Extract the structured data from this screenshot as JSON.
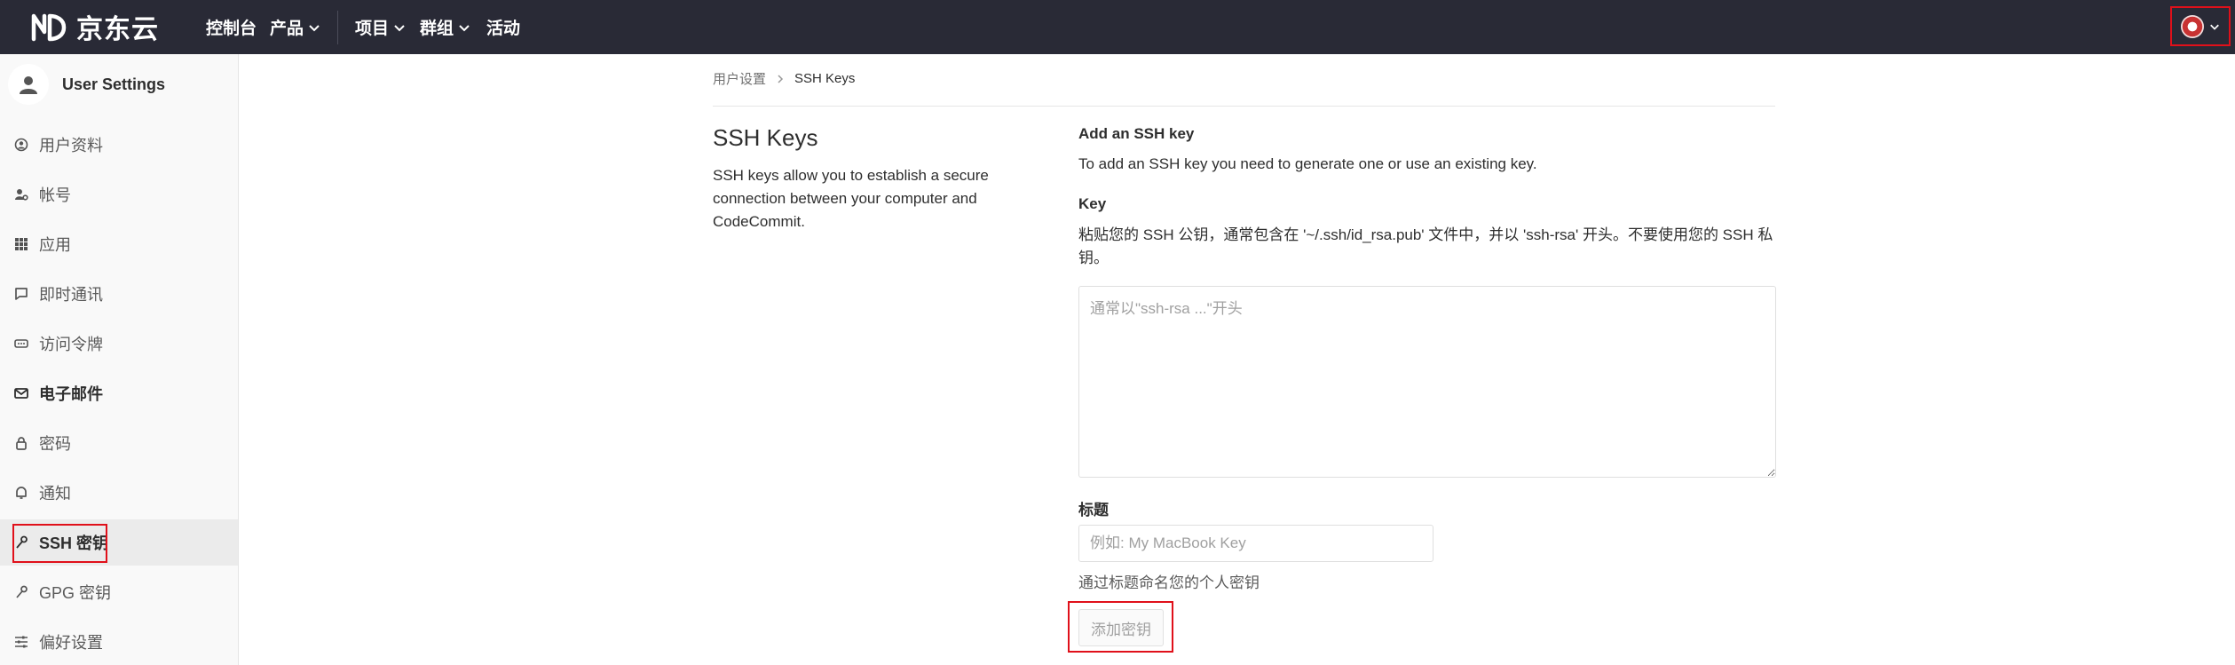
{
  "topbar": {
    "logo_text": "京东云",
    "nav": [
      {
        "label": "控制台",
        "has_dropdown": false
      },
      {
        "label": "产品",
        "has_dropdown": true
      },
      {
        "label": "项目",
        "has_dropdown": true
      },
      {
        "label": "群组",
        "has_dropdown": true
      },
      {
        "label": "活动",
        "has_dropdown": false
      }
    ]
  },
  "sidebar": {
    "title": "User Settings",
    "items": [
      {
        "label": "用户资料",
        "icon": "user-circle-icon"
      },
      {
        "label": "帐号",
        "icon": "account-gear-icon"
      },
      {
        "label": "应用",
        "icon": "grid-apps-icon"
      },
      {
        "label": "即时通讯",
        "icon": "chat-bubble-icon"
      },
      {
        "label": "访问令牌",
        "icon": "token-icon"
      },
      {
        "label": "电子邮件",
        "icon": "envelope-icon"
      },
      {
        "label": "密码",
        "icon": "lock-icon"
      },
      {
        "label": "通知",
        "icon": "bell-icon"
      },
      {
        "label": "SSH 密钥",
        "icon": "key-icon"
      },
      {
        "label": "GPG 密钥",
        "icon": "key-icon"
      },
      {
        "label": "偏好设置",
        "icon": "sliders-icon"
      }
    ]
  },
  "breadcrumb": {
    "parent": "用户设置",
    "current": "SSH Keys"
  },
  "section": {
    "title": "SSH Keys",
    "description": "SSH keys allow you to establish a secure connection between your computer and CodeCommit."
  },
  "form": {
    "heading": "Add an SSH key",
    "intro": "To add an SSH key you need to generate one or use an existing key.",
    "key_label": "Key",
    "key_help": "粘贴您的 SSH 公钥，通常包含在 '~/.ssh/id_rsa.pub' 文件中，并以 'ssh-rsa' 开头。不要使用您的 SSH 私钥。",
    "key_placeholder": "通常以\"ssh-rsa ...\"开头",
    "title_label": "标题",
    "title_placeholder": "例如: My MacBook Key",
    "title_help": "通过标题命名您的个人密钥",
    "submit_label": "添加密钥"
  },
  "colors": {
    "topbar_bg": "#292a36",
    "highlight_border": "#e0101a",
    "sidebar_bg": "#f9f9f9"
  }
}
